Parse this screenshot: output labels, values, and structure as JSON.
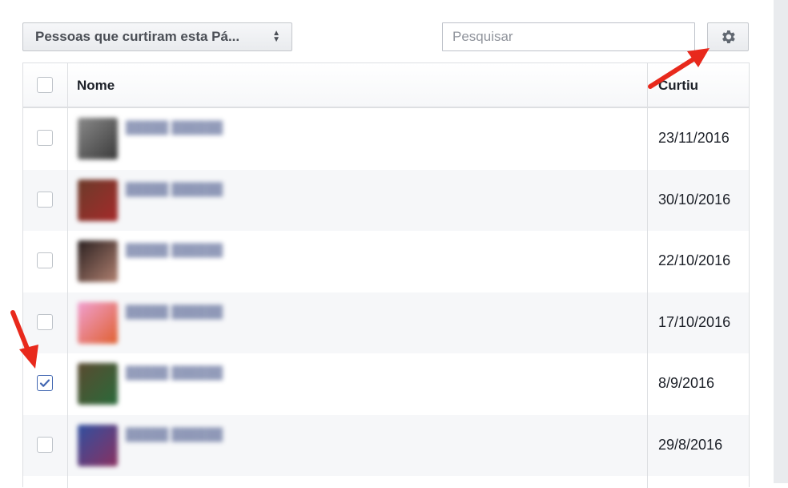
{
  "toolbar": {
    "dropdown_label": "Pessoas que curtiram esta Pá...",
    "search_placeholder": "Pesquisar",
    "settings_icon": "gear-icon"
  },
  "table": {
    "columns": [
      "Nome",
      "Curtiu"
    ],
    "header_checked": false,
    "rows": [
      {
        "checked": false,
        "date": "23/11/2016",
        "avatar_colors": [
          "#8a8a8a",
          "#3a3a3a"
        ]
      },
      {
        "checked": false,
        "date": "30/10/2016",
        "avatar_colors": [
          "#6b3b2a",
          "#a52a2a"
        ]
      },
      {
        "checked": false,
        "date": "22/10/2016",
        "avatar_colors": [
          "#2a2020",
          "#b08070"
        ]
      },
      {
        "checked": false,
        "date": "17/10/2016",
        "avatar_colors": [
          "#f0a0d0",
          "#e06030"
        ]
      },
      {
        "checked": true,
        "date": "8/9/2016",
        "avatar_colors": [
          "#5a4a30",
          "#2a6a3a"
        ]
      },
      {
        "checked": false,
        "date": "29/8/2016",
        "avatar_colors": [
          "#3050a0",
          "#8a3060"
        ]
      }
    ]
  },
  "colors": {
    "accent_arrow": "#e8291c",
    "checkbox_check": "#4267b2"
  }
}
